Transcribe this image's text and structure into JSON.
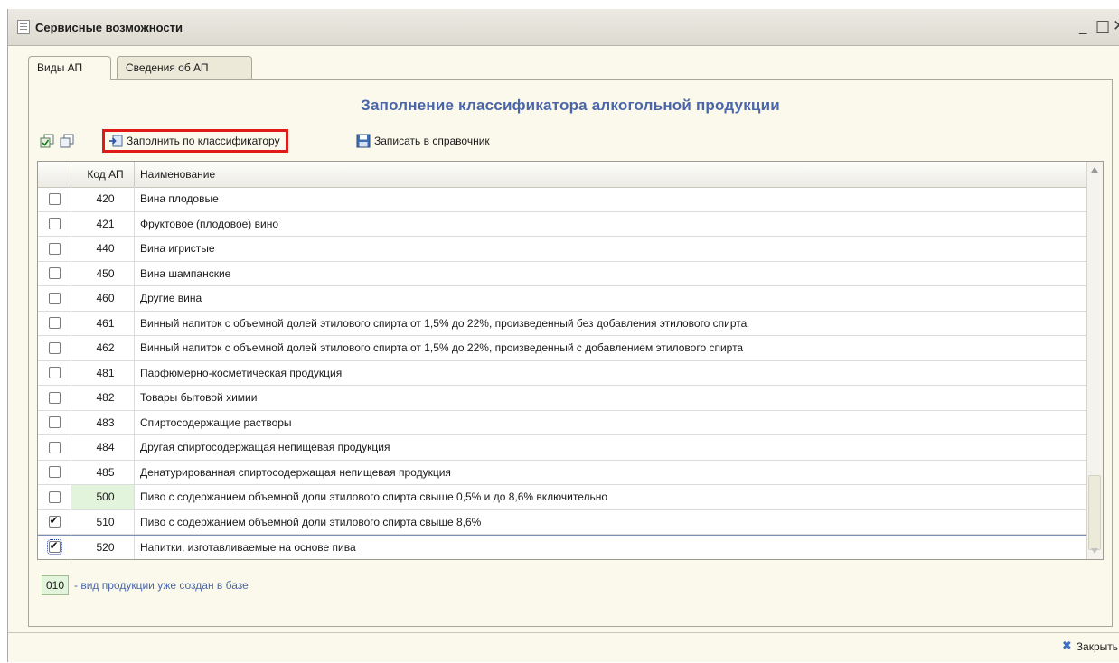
{
  "window": {
    "title": "Сервисные возможности",
    "minimize": "_",
    "maximize": "□",
    "close": "✕"
  },
  "tabs": [
    {
      "label": "Виды АП",
      "active": true
    },
    {
      "label": "Сведения об АП",
      "active": false
    }
  ],
  "header": {
    "title": "Заполнение классификатора алкогольной продукции"
  },
  "toolbar": {
    "check_all_icon": "check-all-icon",
    "uncheck_all_icon": "uncheck-all-icon",
    "fill_label": "Заполнить по классификатору",
    "save_label": "Записать в справочник"
  },
  "table": {
    "columns": [
      "",
      "Код АП",
      "Наименование"
    ],
    "rows": [
      {
        "checked": false,
        "code": "420",
        "name": "Вина плодовые",
        "created": false
      },
      {
        "checked": false,
        "code": "421",
        "name": "Фруктовое (плодовое) вино",
        "created": false
      },
      {
        "checked": false,
        "code": "440",
        "name": "Вина игристые",
        "created": false
      },
      {
        "checked": false,
        "code": "450",
        "name": "Вина шампанские",
        "created": false
      },
      {
        "checked": false,
        "code": "460",
        "name": "Другие вина",
        "created": false
      },
      {
        "checked": false,
        "code": "461",
        "name": "Винный напиток с объемной долей этилового спирта от 1,5% до 22%, произведенный без добавления этилового спирта",
        "created": false
      },
      {
        "checked": false,
        "code": "462",
        "name": "Винный напиток с объемной долей этилового спирта от 1,5% до 22%, произведенный с добавлением этилового спирта",
        "created": false
      },
      {
        "checked": false,
        "code": "481",
        "name": "Парфюмерно-косметическая продукция",
        "created": false
      },
      {
        "checked": false,
        "code": "482",
        "name": "Товары бытовой химии",
        "created": false
      },
      {
        "checked": false,
        "code": "483",
        "name": "Спиртосодержащие растворы",
        "created": false
      },
      {
        "checked": false,
        "code": "484",
        "name": "Другая спиртосодержащая непищевая продукция",
        "created": false
      },
      {
        "checked": false,
        "code": "485",
        "name": "Денатурированная спиртосодержащая непищевая продукция",
        "created": false
      },
      {
        "checked": false,
        "code": "500",
        "name": "Пиво с содержанием объемной доли этилового спирта свыше 0,5% и до 8,6% включительно",
        "created": true
      },
      {
        "checked": true,
        "code": "510",
        "name": "Пиво с содержанием объемной доли этилового спирта свыше 8,6%",
        "created": false
      },
      {
        "checked": true,
        "code": "520",
        "name": "Напитки, изготавливаемые на основе пива",
        "created": false,
        "selected": true
      }
    ]
  },
  "legend": {
    "code": "010",
    "text": "- вид продукции уже создан в базе"
  },
  "footer": {
    "close_label": "Закрыть"
  },
  "colors": {
    "accent": "#4a66a8",
    "created_bg": "#e3f4dc",
    "highlight": "#e01919"
  }
}
